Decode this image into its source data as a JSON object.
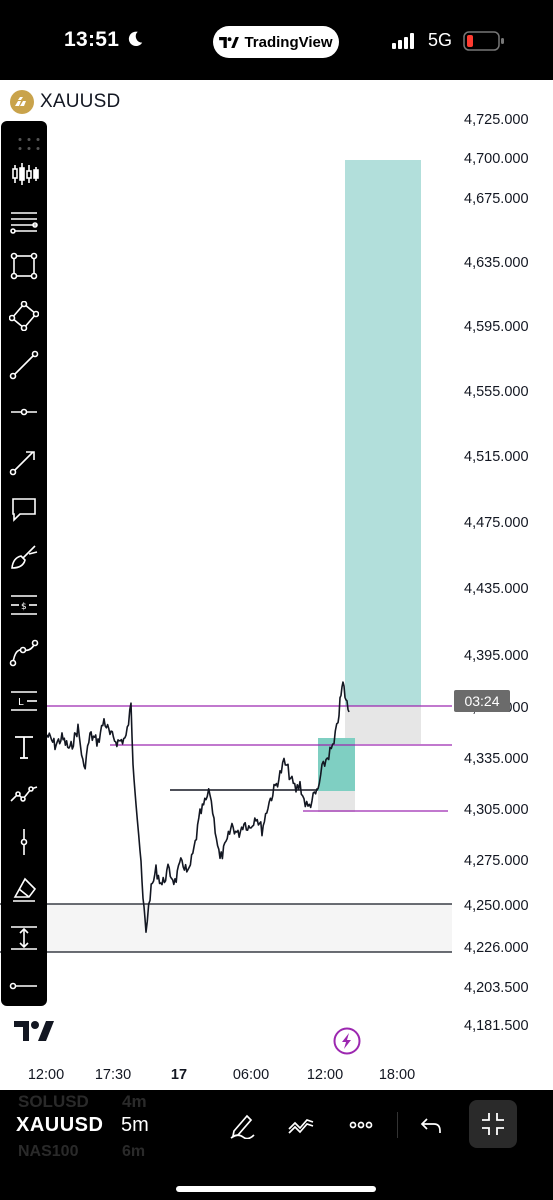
{
  "status": {
    "time": "13:51",
    "app_name": "TradingView",
    "network": "5G"
  },
  "chart": {
    "symbol": "XAUUSD",
    "countdown": "03:24",
    "price_axis": [
      "4,725.000",
      "4,700.000",
      "4,675.000",
      "4,635.000",
      "4,595.000",
      "4,555.000",
      "4,515.000",
      "4,475.000",
      "4,435.000",
      "4,395.000",
      "4,365.000",
      "4,335.000",
      "4,305.000",
      "4,275.000",
      "4,250.000",
      "4,226.000",
      "4,203.500",
      "4,181.500"
    ],
    "time_axis": [
      "12:00",
      "17:30",
      "17",
      "06:00",
      "12:00",
      "18:00"
    ],
    "colors": {
      "purple_line": "#9c27b0",
      "target_zone": "#b2dfdb",
      "stop_zone": "#e6e6e6",
      "candle": "#131722"
    }
  },
  "toolbar": {
    "tools": [
      "candles-icon",
      "trend-lines-icon",
      "rectangle-icon",
      "rotated-rect-icon",
      "line-icon",
      "horizontal-ray-icon",
      "arrow-icon",
      "callout-icon",
      "brush-icon",
      "fib-icon",
      "path-icon",
      "long-position-icon",
      "text-icon",
      "pattern-icon",
      "vertical-line-icon",
      "eraser-icon",
      "measure-icon",
      "horizontal-line-icon"
    ]
  },
  "bottom": {
    "ghost_symbol_top": "SOLUSD",
    "ghost_interval_top": "4m",
    "symbol": "XAUUSD",
    "interval": "5m",
    "ghost_symbol_bottom": "NAS100",
    "ghost_interval_bottom": "6m"
  }
}
